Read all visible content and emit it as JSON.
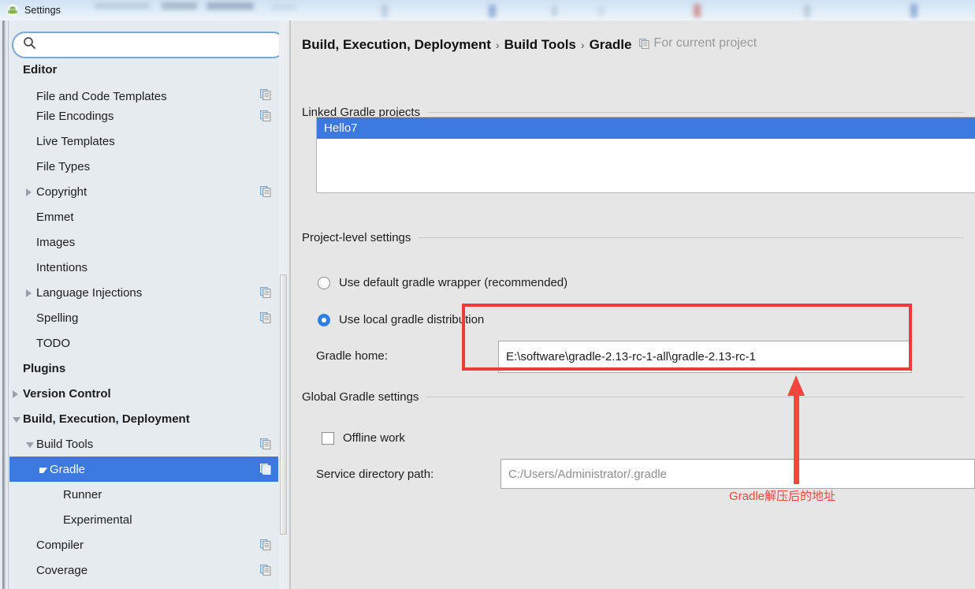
{
  "window": {
    "title": "Settings",
    "icon": "android-robot-icon"
  },
  "sidebar": {
    "search": {
      "value": "",
      "placeholder": ""
    },
    "items": [
      {
        "label": "Editor",
        "indent": 0,
        "bold": true,
        "caret": "none",
        "scope_icon": false,
        "selected": false,
        "clipped": false
      },
      {
        "label": "File and Code Templates",
        "indent": 1,
        "bold": false,
        "caret": "none",
        "scope_icon": true,
        "selected": false,
        "clipped": true
      },
      {
        "label": "File Encodings",
        "indent": 1,
        "bold": false,
        "caret": "none",
        "scope_icon": true,
        "selected": false,
        "clipped": false
      },
      {
        "label": "Live Templates",
        "indent": 1,
        "bold": false,
        "caret": "none",
        "scope_icon": false,
        "selected": false,
        "clipped": false
      },
      {
        "label": "File Types",
        "indent": 1,
        "bold": false,
        "caret": "none",
        "scope_icon": false,
        "selected": false,
        "clipped": false
      },
      {
        "label": "Copyright",
        "indent": 1,
        "bold": false,
        "caret": "right",
        "scope_icon": true,
        "selected": false,
        "clipped": false
      },
      {
        "label": "Emmet",
        "indent": 1,
        "bold": false,
        "caret": "none",
        "scope_icon": false,
        "selected": false,
        "clipped": false
      },
      {
        "label": "Images",
        "indent": 1,
        "bold": false,
        "caret": "none",
        "scope_icon": false,
        "selected": false,
        "clipped": false
      },
      {
        "label": "Intentions",
        "indent": 1,
        "bold": false,
        "caret": "none",
        "scope_icon": false,
        "selected": false,
        "clipped": false
      },
      {
        "label": "Language Injections",
        "indent": 1,
        "bold": false,
        "caret": "right",
        "scope_icon": true,
        "selected": false,
        "clipped": false
      },
      {
        "label": "Spelling",
        "indent": 1,
        "bold": false,
        "caret": "none",
        "scope_icon": true,
        "selected": false,
        "clipped": false
      },
      {
        "label": "TODO",
        "indent": 1,
        "bold": false,
        "caret": "none",
        "scope_icon": false,
        "selected": false,
        "clipped": false
      },
      {
        "label": "Plugins",
        "indent": 0,
        "bold": true,
        "caret": "none",
        "scope_icon": false,
        "selected": false,
        "clipped": false
      },
      {
        "label": "Version Control",
        "indent": 0,
        "bold": true,
        "caret": "right",
        "scope_icon": false,
        "selected": false,
        "clipped": false
      },
      {
        "label": "Build, Execution, Deployment",
        "indent": 0,
        "bold": true,
        "caret": "down",
        "scope_icon": false,
        "selected": false,
        "clipped": false
      },
      {
        "label": "Build Tools",
        "indent": 1,
        "bold": false,
        "caret": "down",
        "scope_icon": true,
        "selected": false,
        "clipped": false
      },
      {
        "label": "Gradle",
        "indent": 2,
        "bold": false,
        "caret": "down",
        "scope_icon": true,
        "selected": true,
        "clipped": false
      },
      {
        "label": "Runner",
        "indent": 3,
        "bold": false,
        "caret": "none",
        "scope_icon": false,
        "selected": false,
        "clipped": false
      },
      {
        "label": "Experimental",
        "indent": 3,
        "bold": false,
        "caret": "none",
        "scope_icon": false,
        "selected": false,
        "clipped": false
      },
      {
        "label": "Compiler",
        "indent": 1,
        "bold": false,
        "caret": "none",
        "scope_icon": true,
        "selected": false,
        "clipped": false
      },
      {
        "label": "Coverage",
        "indent": 1,
        "bold": false,
        "caret": "none",
        "scope_icon": true,
        "selected": false,
        "clipped": false
      }
    ]
  },
  "main": {
    "breadcrumb": {
      "parts": [
        "Build, Execution, Deployment",
        "Build Tools",
        "Gradle"
      ],
      "separator": "›",
      "scope_note": "For current project"
    },
    "linked_projects": {
      "section_label": "Linked Gradle projects",
      "items": [
        {
          "label": "Hello7",
          "selected": true
        }
      ]
    },
    "project_level": {
      "section_label": "Project-level settings",
      "radios": [
        {
          "label": "Use default gradle wrapper (recommended)",
          "checked": false
        },
        {
          "label": "Use local gradle distribution",
          "checked": true
        }
      ],
      "gradle_home": {
        "label": "Gradle home:",
        "value": "E:\\software\\gradle-2.13-rc-1-all\\gradle-2.13-rc-1"
      }
    },
    "global_settings": {
      "section_label": "Global Gradle settings",
      "offline_work": {
        "label": "Offline work",
        "checked": false
      },
      "service_directory": {
        "label": "Service directory path:",
        "value": "",
        "placeholder": "C:/Users/Administrator/.gradle"
      }
    }
  },
  "annotations": {
    "box_color": "#ef3b35",
    "arrow_color": "#f4463f",
    "note": "Gradle解压后的地址"
  },
  "colors": {
    "selection_blue": "#3b79de",
    "sidebar_bg": "#e5ebef",
    "main_bg": "#e6e6e6",
    "annotation_red": "#ef3b35"
  }
}
